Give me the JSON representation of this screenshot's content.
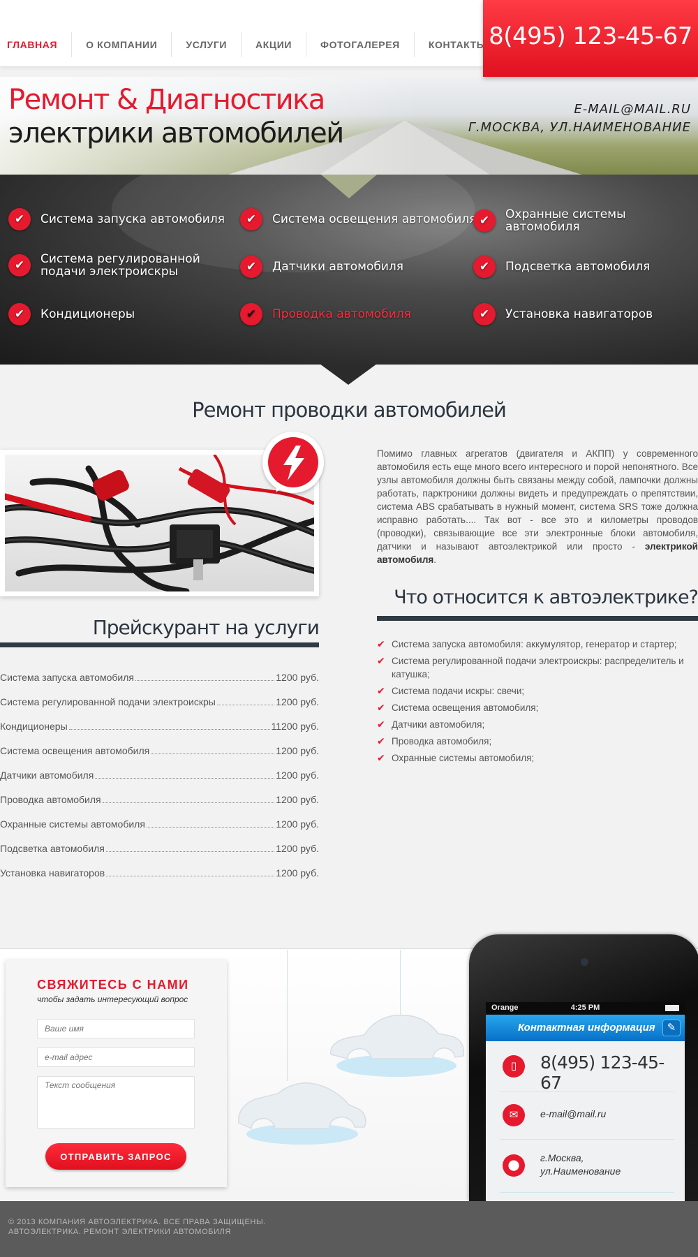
{
  "nav": {
    "items": [
      {
        "label": "ГЛАВНАЯ"
      },
      {
        "label": "О КОМПАНИИ"
      },
      {
        "label": "УСЛУГИ"
      },
      {
        "label": "АКЦИИ"
      },
      {
        "label": "ФОТОГАЛЕРЕЯ"
      },
      {
        "label": "КОНТАКТЫ"
      }
    ],
    "active_index": 0
  },
  "header": {
    "phone": "8(495) 123-45-67"
  },
  "hero": {
    "title_line1": "Ремонт & Диагностика",
    "title_line2": "электрики автомобилей",
    "email": "E-MAIL@MAIL.RU",
    "address": "Г.МОСКВА, УЛ.НАИМЕНОВАНИЕ"
  },
  "services": {
    "items": [
      {
        "label": "Система запуска автомобиля"
      },
      {
        "label": "Система освещения автомобиля"
      },
      {
        "label": "Охранные системы автомобиля"
      },
      {
        "label": "Система регулированной подачи электроискры"
      },
      {
        "label": "Датчики автомобиля"
      },
      {
        "label": "Подсветка автомобиля"
      },
      {
        "label": "Кондиционеры"
      },
      {
        "label": "Проводка автомобиля"
      },
      {
        "label": "Установка навигаторов"
      }
    ],
    "active_index": 7,
    "check_glyph": "✔"
  },
  "main": {
    "title": "Ремонт проводки автомобилей",
    "intro_text": "Помимо главных агрегатов (двигателя и АКПП) у современного автомобиля есть еще много всего интересного и порой непонятного. Все узлы автомобиля должны быть связаны между собой, лампочки должны работать, парктроники должны видеть и предупреждать о препятствии, система ABS срабатывать в нужный момент, система SRS тоже должна исправно работать.... Так вот - все это и километры проводов (проводки), связывающие все эти электронные блоки автомобиля, датчики и называют автоэлектрикой или просто -",
    "intro_bold": "электрикой автомобиля",
    "intro_end": ".",
    "features_heading": "Что относится к автоэлектрике?",
    "features": [
      "Система запуска автомобиля: аккумулятор, генератор и стартер;",
      "Система регулированной подачи электроискры: распределитель и катушка;",
      "Система подачи искры: свечи;",
      "Система освещения автомобиля;",
      "Датчики автомобиля;",
      "Проводка автомобиля;",
      "Охранные системы автомобиля;"
    ],
    "tick_glyph": "✔"
  },
  "pricelist": {
    "heading": "Прейскурант на услуги",
    "items": [
      {
        "name": "Система запуска автомобиля",
        "price": "1200 руб."
      },
      {
        "name": "Система регулированной подачи электроискры",
        "price": "1200 руб."
      },
      {
        "name": "Кондиционеры",
        "price": "11200 руб."
      },
      {
        "name": "Система освещения автомобиля",
        "price": "1200 руб."
      },
      {
        "name": "Датчики автомобиля",
        "price": "1200 руб."
      },
      {
        "name": "Проводка автомобиля",
        "price": "1200 руб."
      },
      {
        "name": "Охранные системы автомобиля",
        "price": "1200 руб."
      },
      {
        "name": "Подсветка автомобиля",
        "price": "1200 руб."
      },
      {
        "name": "Установка навигаторов",
        "price": "1200 руб."
      }
    ]
  },
  "contact_form": {
    "title": "СВЯЖИТЕСЬ С НАМИ",
    "subtitle": "чтобы задать интересующий вопрос",
    "name_placeholder": "Ваше имя",
    "email_placeholder": "e-mail адрес",
    "message_placeholder": "Текст сообщения",
    "submit_label": "ОТПРАВИТЬ ЗАПРОС"
  },
  "phone_mockup": {
    "carrier": "Orange",
    "time": "4:25 PM",
    "app_title": "Контактная информация",
    "phone": "8(495) 123-45-67",
    "email": "e-mail@mail.ru",
    "address_line1": "г.Москва,",
    "address_line2": "ул.Наименование"
  },
  "footer": {
    "line1": "© 2013 КОМПАНИЯ АВТОЭЛЕКТРИКА. ВСЕ ПРАВА ЗАЩИЩЕНЫ.",
    "line2": "АВТОЭЛЕКТРИКА. РЕМОНТ ЭЛЕКТРИКИ АВТОМОБИЛЯ"
  },
  "colors": {
    "accent": "#e51a2e",
    "dark_bar": "#2f3a42",
    "footer_bg": "#5b5b5b",
    "app_blue": "#1a8ee0"
  },
  "icons": {
    "service_check": "check-icon",
    "badge": "lightning-icon",
    "contact_phone": "mobile-phone-icon",
    "contact_email": "envelope-icon",
    "contact_address": "location-pin-icon",
    "app_edit": "edit-icon"
  }
}
